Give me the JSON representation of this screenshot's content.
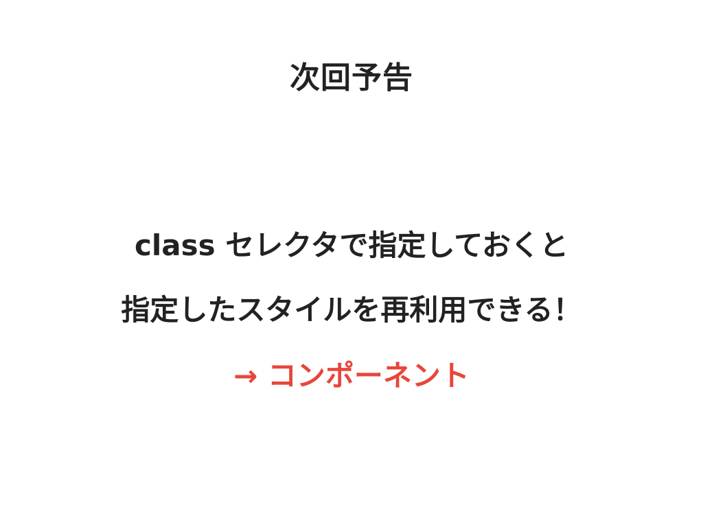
{
  "slide": {
    "title": "次回予告",
    "lines": [
      "class セレクタで指定しておくと",
      "指定したスタイルを再利用できる！",
      "→ コンポーネント"
    ],
    "accent_color": "#e8463a",
    "text_color": "#222222",
    "background_color": "#ffffff"
  }
}
